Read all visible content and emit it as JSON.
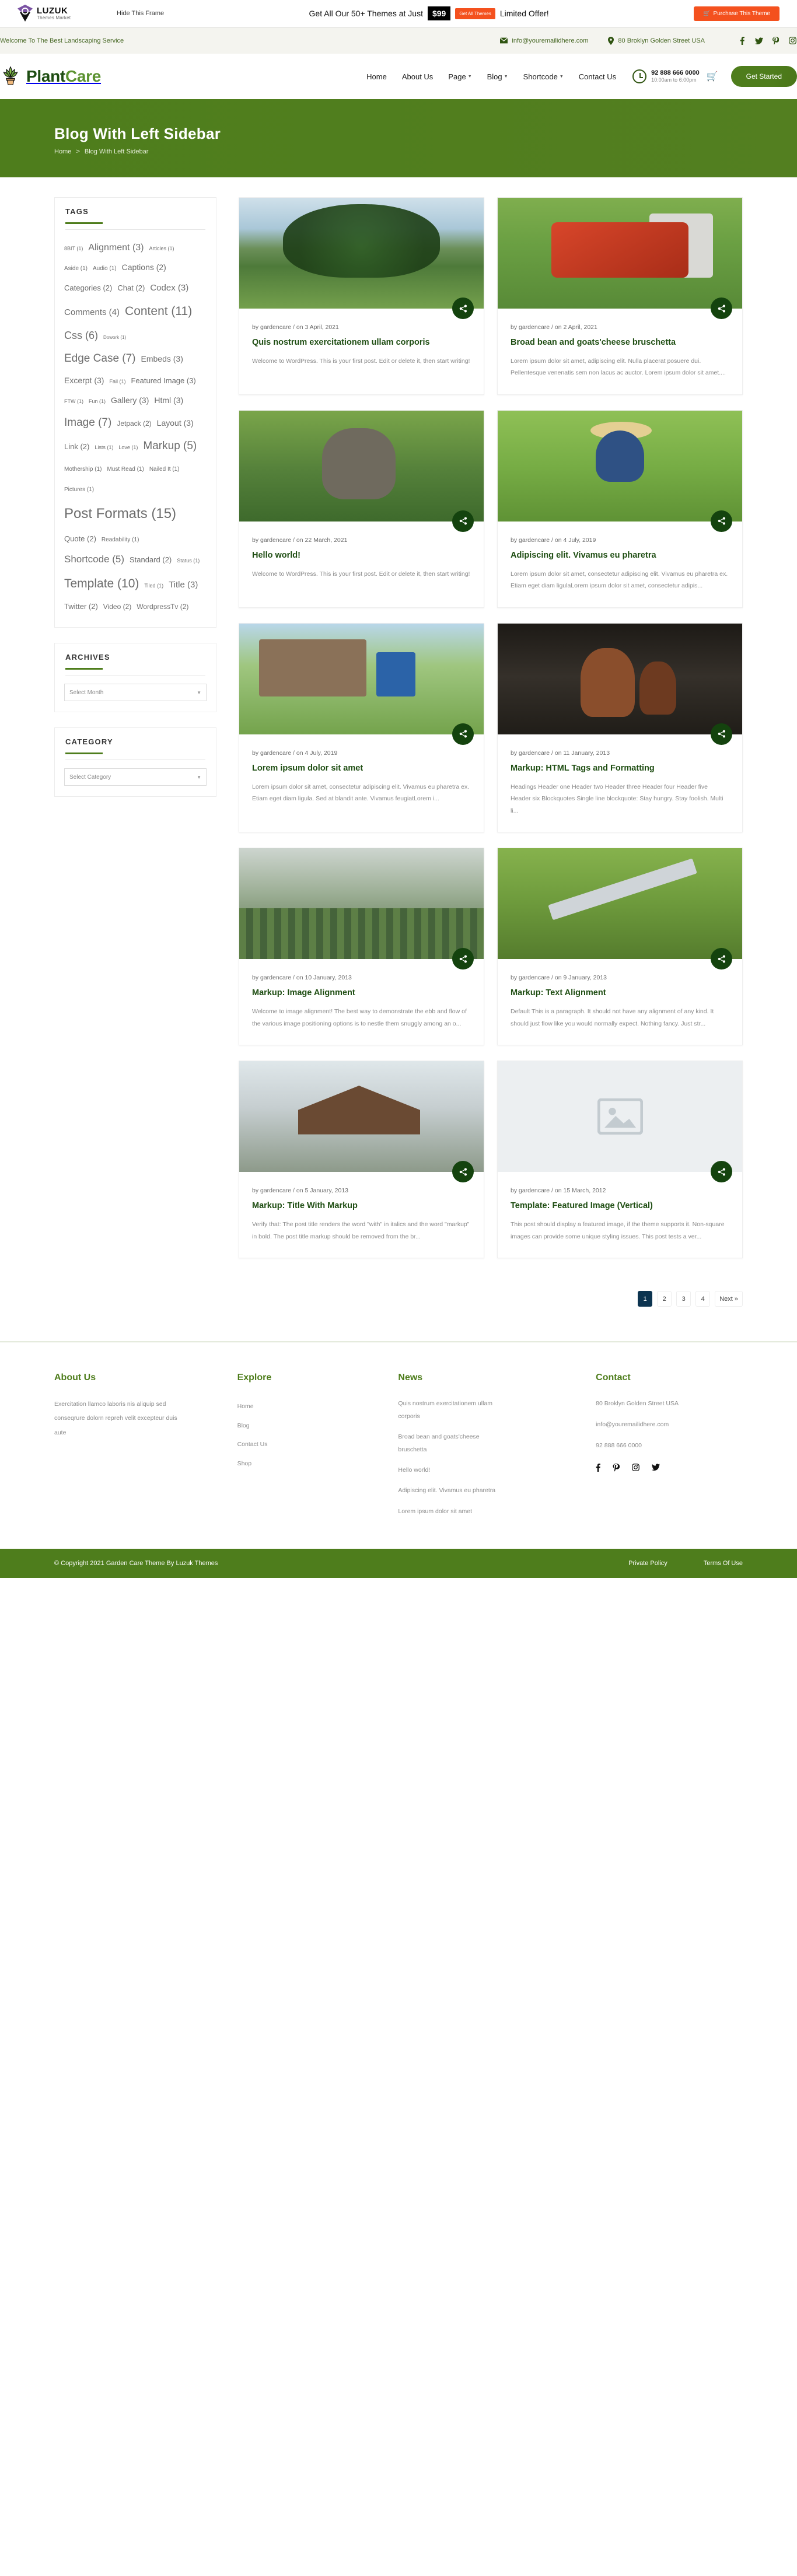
{
  "promo": {
    "brand_line1": "LUZUK",
    "brand_line2": "Themes Market",
    "hide_frame": "Hide This Frame",
    "offer_pre": "Get All Our 50+ Themes at Just",
    "price": "$99",
    "get_all_themes": "Get All Themes",
    "offer_post": "Limited Offer!",
    "purchase": "Purchase This Theme",
    "cart_icon": "cart-icon"
  },
  "topbar": {
    "welcome": "Welcome To The Best Landscaping Service",
    "email": "info@youremailidhere.com",
    "address": "80 Broklyn Golden Street USA",
    "email_icon": "envelope-icon",
    "location_icon": "map-pin-icon",
    "socials": [
      {
        "name": "facebook-icon",
        "glyph": "f"
      },
      {
        "name": "twitter-icon",
        "glyph": "ᵛ"
      },
      {
        "name": "pinterest-icon",
        "glyph": "ơ"
      },
      {
        "name": "instagram-icon",
        "glyph": "□"
      }
    ]
  },
  "header": {
    "brand_a": "Plant",
    "brand_b": "Care",
    "logo_icon": "plant-pot-icon",
    "nav": [
      {
        "label": "Home",
        "caret": false
      },
      {
        "label": "About Us",
        "caret": false
      },
      {
        "label": "Page",
        "caret": true
      },
      {
        "label": "Blog",
        "caret": true
      },
      {
        "label": "Shortcode",
        "caret": true
      },
      {
        "label": "Contact Us",
        "caret": false
      }
    ],
    "phone": "92 888 666 0000",
    "hours": "10:00am to 6:00pm",
    "clock_icon": "clock-icon",
    "cart_icon": "shopping-cart-icon",
    "cta": "Get Started"
  },
  "banner": {
    "title": "Blog With Left Sidebar",
    "crumb_home": "Home",
    "crumb_sep": ">",
    "crumb_current": "Blog With Left Sidebar"
  },
  "sidebar": {
    "tags_title": "TAGS",
    "tags": [
      {
        "label": "8BIT (1)",
        "size": 9
      },
      {
        "label": "Alignment (3)",
        "size": 16
      },
      {
        "label": "Articles (1)",
        "size": 9
      },
      {
        "label": "Aside (1)",
        "size": 10
      },
      {
        "label": "Audio (1)",
        "size": 10
      },
      {
        "label": "Captions (2)",
        "size": 14
      },
      {
        "label": "Categories (2)",
        "size": 13
      },
      {
        "label": "Chat (2)",
        "size": 13
      },
      {
        "label": "Codex (3)",
        "size": 15
      },
      {
        "label": "Comments (4)",
        "size": 15
      },
      {
        "label": "Content (11)",
        "size": 21
      },
      {
        "label": "Css (6)",
        "size": 18
      },
      {
        "label": "Dowork (1)",
        "size": 8
      },
      {
        "label": "Edge Case (7)",
        "size": 19
      },
      {
        "label": "Embeds (3)",
        "size": 14
      },
      {
        "label": "Excerpt (3)",
        "size": 14
      },
      {
        "label": "Fail (1)",
        "size": 9
      },
      {
        "label": "Featured Image (3)",
        "size": 13
      },
      {
        "label": "FTW (1)",
        "size": 9
      },
      {
        "label": "Fun (1)",
        "size": 9
      },
      {
        "label": "Gallery (3)",
        "size": 14
      },
      {
        "label": "Html (3)",
        "size": 14
      },
      {
        "label": "Image (7)",
        "size": 19
      },
      {
        "label": "Jetpack (2)",
        "size": 12
      },
      {
        "label": "Layout (3)",
        "size": 14
      },
      {
        "label": "Link (2)",
        "size": 13
      },
      {
        "label": "Lists (1)",
        "size": 9
      },
      {
        "label": "Love (1)",
        "size": 9
      },
      {
        "label": "Markup (5)",
        "size": 19
      },
      {
        "label": "Mothership (1)",
        "size": 10
      },
      {
        "label": "Must Read (1)",
        "size": 10
      },
      {
        "label": "Nailed It (1)",
        "size": 10
      },
      {
        "label": "Pictures (1)",
        "size": 10
      },
      {
        "label": "Post Formats (15)",
        "size": 24
      },
      {
        "label": "Quote (2)",
        "size": 13
      },
      {
        "label": "Readability (1)",
        "size": 10
      },
      {
        "label": "Shortcode (5)",
        "size": 17
      },
      {
        "label": "Standard (2)",
        "size": 13
      },
      {
        "label": "Status (1)",
        "size": 9
      },
      {
        "label": "Template (10)",
        "size": 21
      },
      {
        "label": "Tiled (1)",
        "size": 9
      },
      {
        "label": "Title (3)",
        "size": 15
      },
      {
        "label": "Twitter (2)",
        "size": 13
      },
      {
        "label": "Video (2)",
        "size": 12
      },
      {
        "label": "WordpressTv (2)",
        "size": 12
      }
    ],
    "archives_title": "ARCHIVES",
    "archives_selected": "Select Month",
    "category_title": "CATEGORY",
    "category_selected": "Select Category",
    "chevron_icon": "chevron-down-icon"
  },
  "posts": [
    {
      "meta": "by gardencare / on 3 April, 2021",
      "title": "Quis nostrum exercitationem ullam corporis",
      "excerpt": "Welcome to WordPress. This is your first post. Edit or delete it, then start writing!",
      "share_icon": "share-icon",
      "img": "g1"
    },
    {
      "meta": "by gardencare / on 2 April, 2021",
      "title": "Broad bean and goats'cheese bruschetta",
      "excerpt": "Lorem ipsum dolor sit amet, adipiscing elit. Nulla placerat posuere dui. Pellentesque venenatis sem non lacus ac auctor. Lorem ipsum dolor sit amet....",
      "share_icon": "share-icon",
      "img": "g2"
    },
    {
      "meta": "by gardencare / on 22 March, 2021",
      "title": "Hello world!",
      "excerpt": "Welcome to WordPress. This is your first post. Edit or delete it, then start writing!",
      "share_icon": "share-icon",
      "img": "g3"
    },
    {
      "meta": "by gardencare / on 4 July, 2019",
      "title": "Adipiscing elit. Vivamus eu pharetra",
      "excerpt": "Lorem ipsum dolor sit amet, consectetur adipiscing elit. Vivamus eu pharetra ex. Etiam eget diam ligulaLorem ipsum dolor sit amet, consectetur adipis...",
      "share_icon": "share-icon",
      "img": "g4"
    },
    {
      "meta": "by gardencare / on 4 July, 2019",
      "title": "Lorem ipsum dolor sit amet",
      "excerpt": "Lorem ipsum dolor sit amet, consectetur adipiscing elit. Vivamus eu pharetra ex. Etiam eget diam ligula. Sed at blandit ante. Vivamus feugiatLorem i...",
      "share_icon": "share-icon",
      "img": "g5"
    },
    {
      "meta": "by gardencare / on 11 January, 2013",
      "title": "Markup: HTML Tags and Formatting",
      "excerpt": "Headings Header one Header two Header three Header four Header five Header six Blockquotes Single line blockquote: Stay hungry. Stay foolish. Multi li...",
      "share_icon": "share-icon",
      "img": "g6"
    },
    {
      "meta": "by gardencare / on 10 January, 2013",
      "title": "Markup: Image Alignment",
      "excerpt": "Welcome to image alignment! The best way to demonstrate the ebb and flow of the various image positioning options is to nestle them snuggly among an o...",
      "share_icon": "share-icon",
      "img": "g7"
    },
    {
      "meta": "by gardencare / on 9 January, 2013",
      "title": "Markup: Text Alignment",
      "excerpt": "Default This is a paragraph. It should not have any alignment of any kind. It should just flow like you would normally expect. Nothing fancy. Just str...",
      "share_icon": "share-icon",
      "img": "g8"
    },
    {
      "meta": "by gardencare / on 5 January, 2013",
      "title": "Markup: Title With Markup",
      "excerpt": "Verify that: The post title renders the word \"with\" in italics and the word \"markup\" in bold. The post title markup should be removed from the br...",
      "share_icon": "share-icon",
      "img": "g9"
    },
    {
      "meta": "by gardencare / on 15 March, 2012",
      "title": "Template: Featured Image (Vertical)",
      "excerpt": "This post should display a featured image, if the theme supports it. Non-square images can provide some unique styling issues. This post tests a ver...",
      "share_icon": "share-icon",
      "img": "placeholder"
    }
  ],
  "pagination": {
    "pages": [
      "1",
      "2",
      "3",
      "4"
    ],
    "active": "1",
    "next": "Next »"
  },
  "footer": {
    "about_title": "About Us",
    "about_text": "Exercitation llamco laboris nis aliquip sed conseqrure dolorn repreh velit excepteur duis aute",
    "explore_title": "Explore",
    "explore_links": [
      "Home",
      "Blog",
      "Contact Us",
      "Shop"
    ],
    "news_title": "News",
    "news_links": [
      "Quis nostrum exercitationem ullam corporis",
      "Broad bean and goats'cheese bruschetta",
      "Hello world!",
      "Adipiscing elit. Vivamus eu pharetra",
      "Lorem ipsum dolor sit amet"
    ],
    "contact_title": "Contact",
    "contact_address": "80 Broklyn Golden Street USA",
    "contact_email": "info@youremailidhere.com",
    "contact_phone": "92 888 666 0000",
    "socials": [
      {
        "name": "facebook-icon",
        "glyph": "f"
      },
      {
        "name": "pinterest-icon",
        "glyph": "ơ"
      },
      {
        "name": "instagram-icon",
        "glyph": "□"
      },
      {
        "name": "twitter-icon",
        "glyph": "ᵛ"
      }
    ],
    "copyright": "© Copyright 2021 Garden Care Theme By Luzuk Themes",
    "private_policy": "Private Policy",
    "terms": "Terms Of Use"
  },
  "colors": {
    "green": "#4e7d1c",
    "dark_green": "#1e4d12",
    "orange": "#f4511e",
    "navy": "#0c3450"
  }
}
